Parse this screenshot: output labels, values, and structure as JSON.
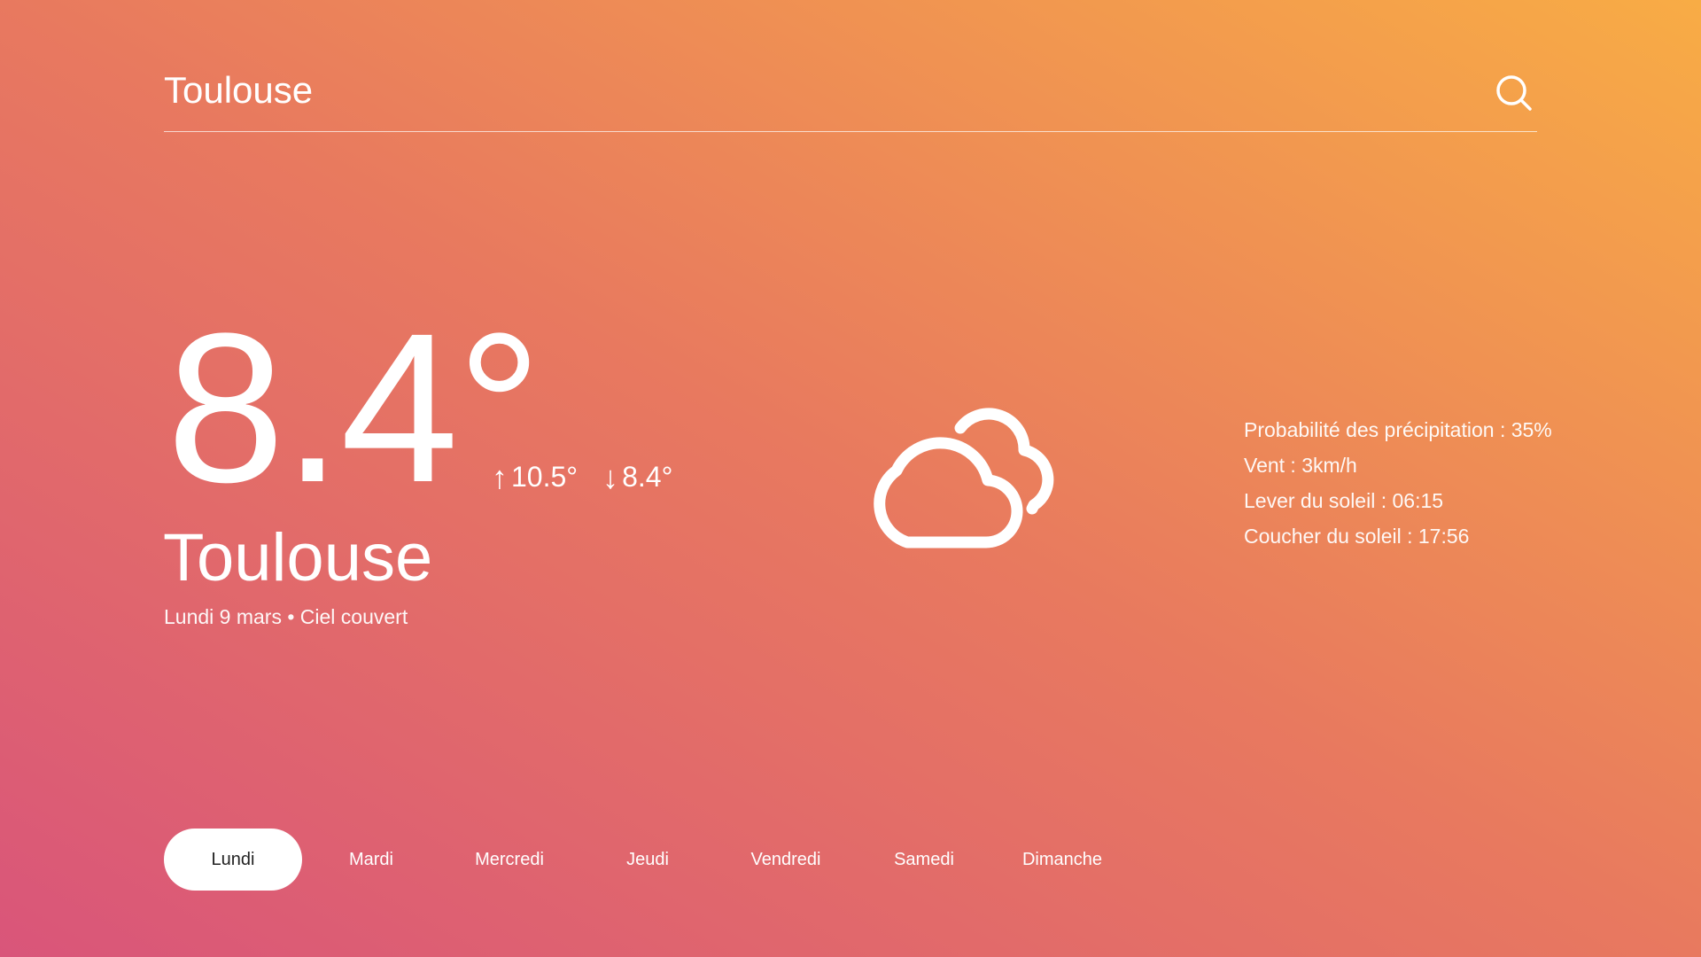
{
  "search": {
    "value": "Toulouse",
    "icon": "search-icon"
  },
  "current": {
    "temperature": "8.4°",
    "max": "10.5°",
    "min": "8.4°",
    "city": "Toulouse",
    "subline": "Lundi 9 mars • Ciel couvert",
    "icon": "cloudy-icon"
  },
  "details": [
    "Probabilité des précipitation : 35%",
    "Vent : 3km/h",
    "Lever du soleil : 06:15",
    "Coucher du soleil : 17:56"
  ],
  "days": [
    "Lundi",
    "Mardi",
    "Mercredi",
    "Jeudi",
    "Vendredi",
    "Samedi",
    "Dimanche"
  ],
  "selected_day": "Lundi",
  "colors": {
    "gradient_start": "#d9557a",
    "gradient_end": "#f8ac45",
    "text": "#ffffff"
  }
}
